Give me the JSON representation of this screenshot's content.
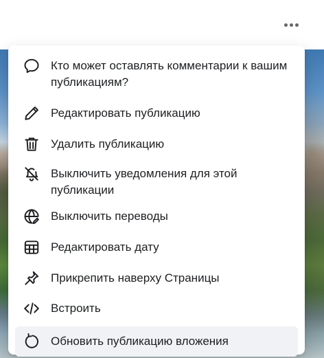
{
  "post": {
    "more_button_icon": "more-horizontal-icon"
  },
  "menu": {
    "items": [
      {
        "label": "Кто может оставлять комментарии к вашим публикациям?",
        "icon": "comment-icon"
      },
      {
        "label": "Редактировать публикацию",
        "icon": "pencil-icon"
      },
      {
        "label": "Удалить публикацию",
        "icon": "trash-icon"
      },
      {
        "label": "Выключить уведомления для этой публикации",
        "icon": "bell-off-icon"
      },
      {
        "label": "Выключить переводы",
        "icon": "globe-edit-icon"
      },
      {
        "label": "Редактировать дату",
        "icon": "calendar-icon"
      },
      {
        "label": "Прикрепить наверху Страницы",
        "icon": "pin-icon"
      },
      {
        "label": "Встроить",
        "icon": "code-icon"
      },
      {
        "label": "Обновить публикацию вложения",
        "icon": "refresh-icon"
      }
    ]
  },
  "colors": {
    "text": "#1c1e21",
    "hover_background": "#f0f2f5",
    "menu_background": "#ffffff"
  }
}
